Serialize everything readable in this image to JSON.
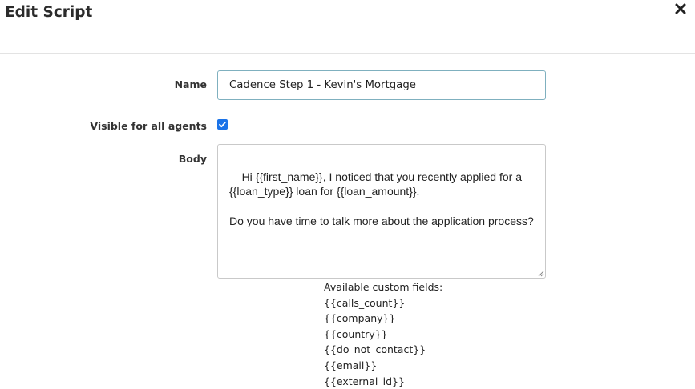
{
  "dialog": {
    "title": "Edit Script",
    "close_icon": "close-icon"
  },
  "form": {
    "name_label": "Name",
    "name_value": "Cadence Step 1 - Kevin's Mortgage",
    "visible_label": "Visible for all agents",
    "visible_checked": true,
    "body_label": "Body",
    "body_value": "Hi {{first_name}}, I noticed that you recently applied for a {{loan_type}} loan for {{loan_amount}}.\n\nDo you have time to talk more about the application process?"
  },
  "custom_fields": {
    "heading": "Available custom fields:",
    "items": [
      "{{calls_count}}",
      "{{company}}",
      "{{country}}",
      "{{do_not_contact}}",
      "{{email}}",
      "{{external_id}}"
    ]
  },
  "colors": {
    "checkbox_accent": "#1a73e8",
    "input_focus_border": "#7fb0bf"
  }
}
